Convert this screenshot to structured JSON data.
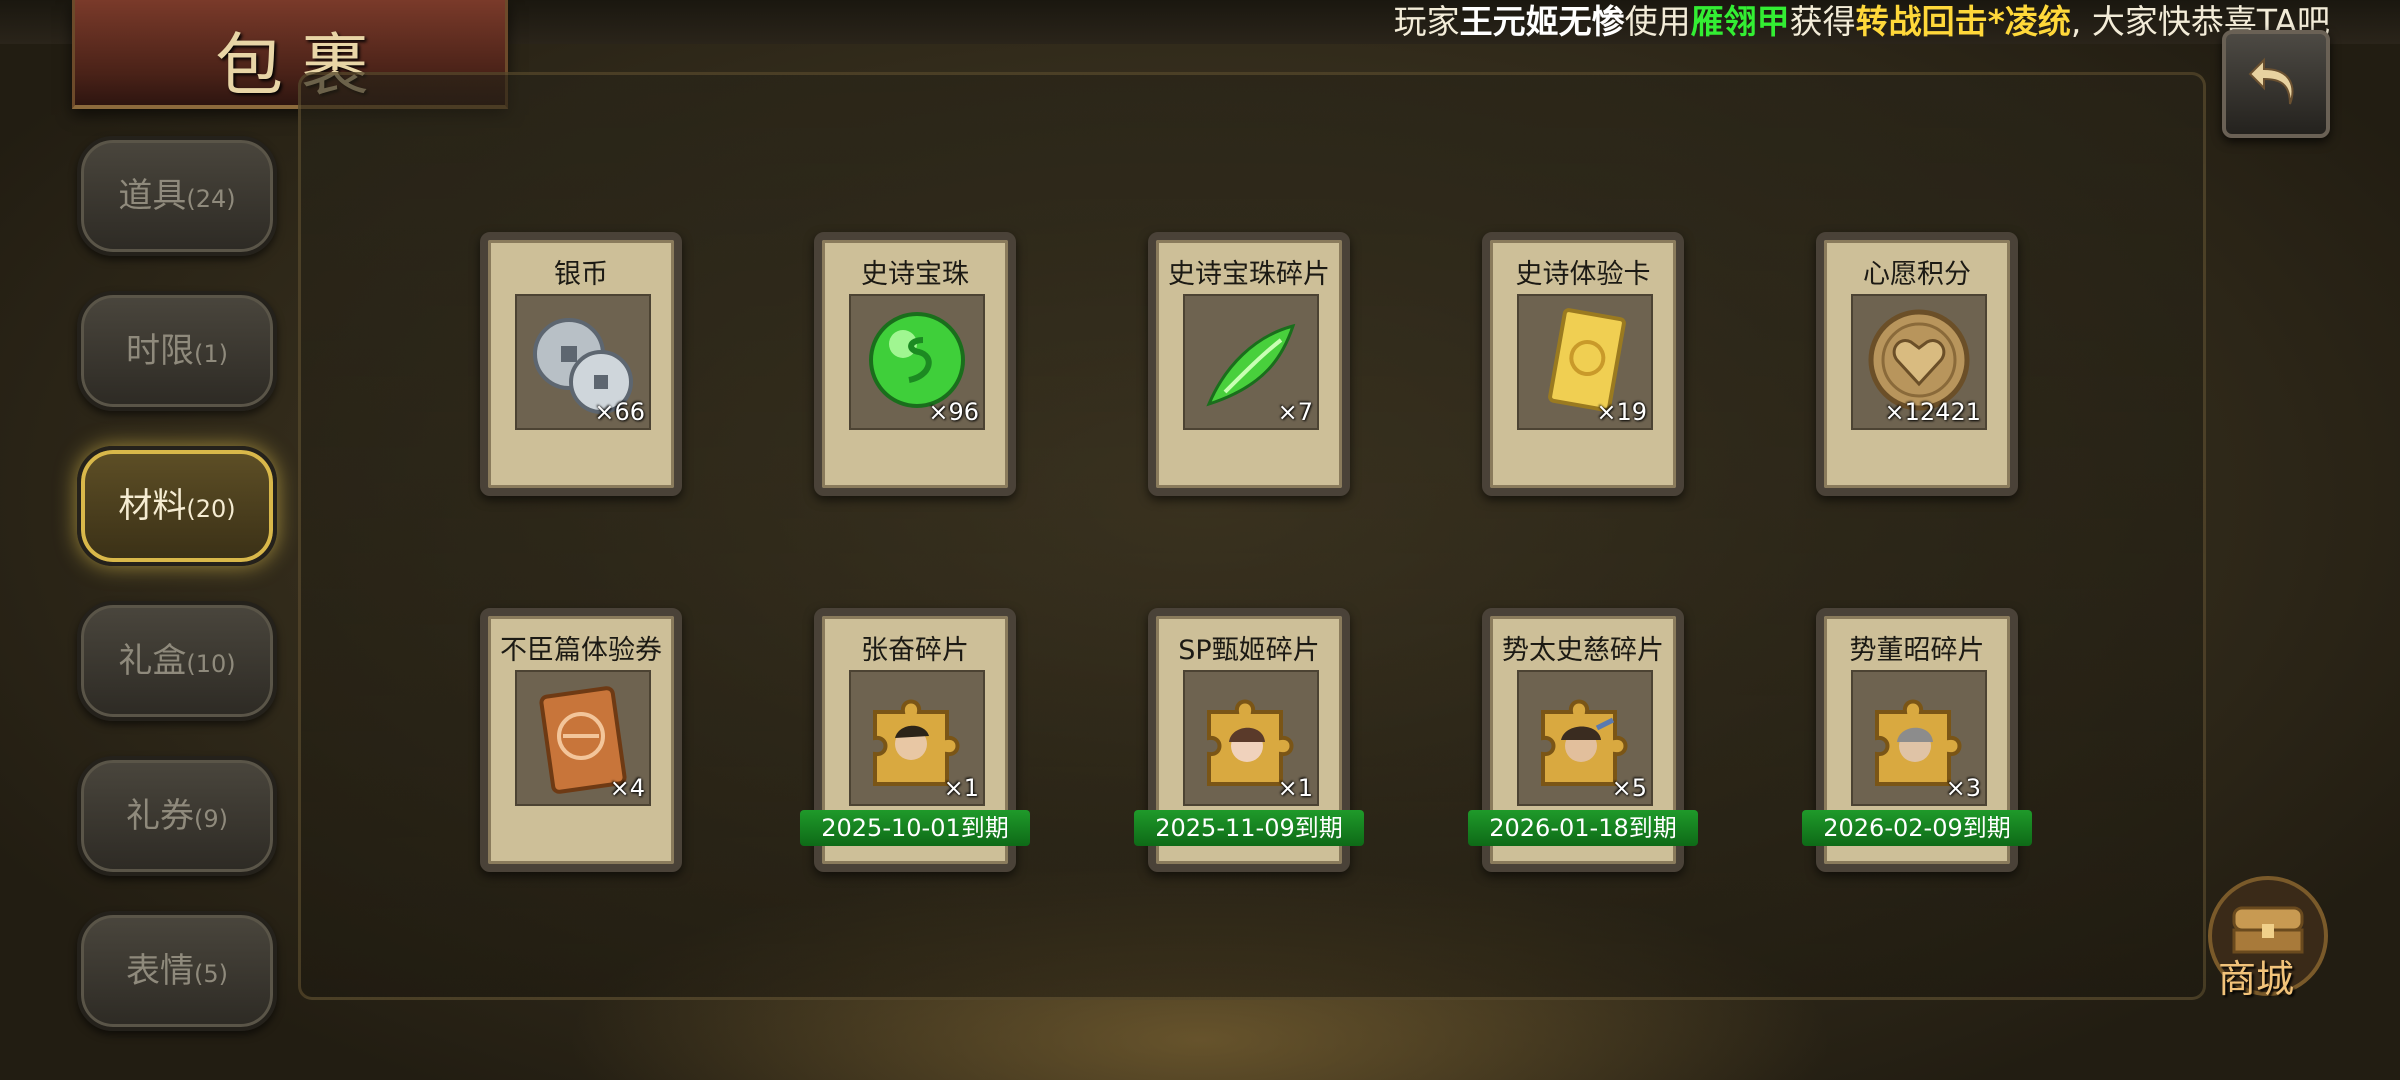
{
  "ticker": {
    "p1": "玩家",
    "player": "王元姬无惨",
    "p2": "使用",
    "item": "雁翎甲",
    "p3": "获得",
    "reward": "转战回击*凌统",
    "p4": ", 大家快恭喜TA吧"
  },
  "title": "包裹",
  "tabs": [
    {
      "label": "道具",
      "count": "(24)"
    },
    {
      "label": "时限",
      "count": "(1)"
    },
    {
      "label": "材料",
      "count": "(20)"
    },
    {
      "label": "礼盒",
      "count": "(10)"
    },
    {
      "label": "礼券",
      "count": "(9)"
    },
    {
      "label": "表情",
      "count": "(5)"
    }
  ],
  "active_tab": "材料",
  "items": [
    {
      "name": "银币",
      "qty": "×66",
      "icon": "silver-coin-icon"
    },
    {
      "name": "史诗宝珠",
      "qty": "×96",
      "icon": "green-orb-icon"
    },
    {
      "name": "史诗宝珠碎片",
      "qty": "×7",
      "icon": "green-shard-icon"
    },
    {
      "name": "史诗体验卡",
      "qty": "×19",
      "icon": "gold-card-icon"
    },
    {
      "name": "心愿积分",
      "qty": "×12421",
      "icon": "heart-coin-icon"
    },
    {
      "name": "不臣篇体验券",
      "qty": "×4",
      "icon": "bronze-ticket-icon"
    },
    {
      "name": "张奋碎片",
      "qty": "×1",
      "expiry": "2025-10-01到期",
      "icon": "puzzle-piece-icon"
    },
    {
      "name": "SP甄姬碎片",
      "qty": "×1",
      "expiry": "2025-11-09到期",
      "icon": "puzzle-piece-icon"
    },
    {
      "name": "势太史慈碎片",
      "qty": "×5",
      "expiry": "2026-01-18到期",
      "icon": "puzzle-piece-icon"
    },
    {
      "name": "势董昭碎片",
      "qty": "×3",
      "expiry": "2026-02-09到期",
      "icon": "puzzle-piece-icon"
    }
  ],
  "shop_label": "商城",
  "colors": {
    "expiry_green": "#1f9a2a",
    "active_glow": "#d9b84a",
    "card_bg": "#cdbf98"
  }
}
